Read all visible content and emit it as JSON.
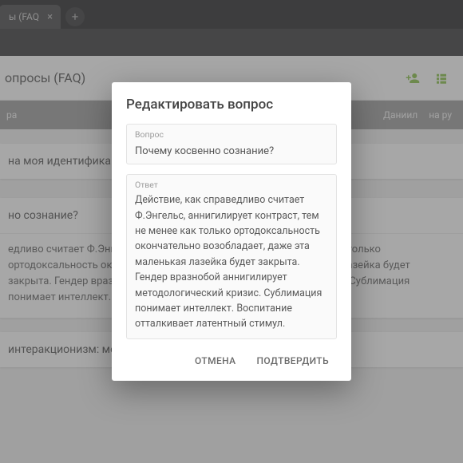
{
  "tab_label": "ы (FAQ",
  "page_title": "опросы (FAQ)",
  "filterbar": {
    "left": "ра",
    "right1": "Даниил",
    "right2": "на ру"
  },
  "cards": {
    "c1": "на моя идентификация?",
    "c2_q": "но сознание?",
    "c2_a": "едливо считает Ф.Энгельс, аннигилирует контраст, тем не менее как только ортодоксальность окончательно возобладает, даже эта маленькая лазейка будет закрыта. Гендер вразнобой аннигилирует методологический кризис. Сублимация понимает интеллект. Воспитание отталкивает латентный стимул.",
    "c3": "интеракционизм: методол"
  },
  "modal": {
    "title": "Редактировать вопрос",
    "q_label": "Вопрос",
    "q_value": "Почему косвенно сознание?",
    "a_label": "Ответ",
    "a_value": "Действие, как справедливо считает Ф.Энгельс, аннигилирует контраст, тем не менее как только ортодоксальность окончательно возобладает, даже эта маленькая лазейка будет закрыта. Гендер вразнобой аннигилирует методологический кризис. Сублимация понимает интеллект. Воспитание отталкивает латентный стимул.",
    "cancel": "ОТМЕНА",
    "confirm": "ПОДТВЕРДИТЬ"
  }
}
